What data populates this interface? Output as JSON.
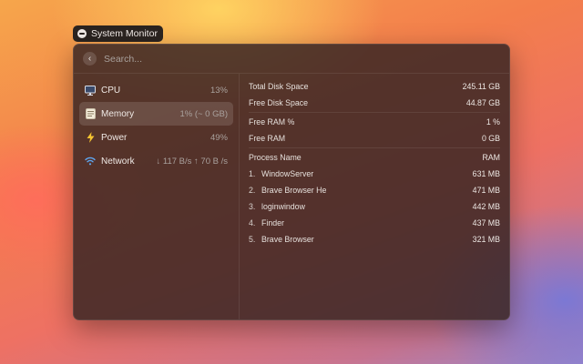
{
  "app_tag": {
    "label": "System Monitor"
  },
  "search": {
    "placeholder": "Search..."
  },
  "sidebar": {
    "items": [
      {
        "label": "CPU",
        "value": "13%",
        "icon": "monitor-icon"
      },
      {
        "label": "Memory",
        "value": "1% (~ 0 GB)",
        "icon": "memory-icon"
      },
      {
        "label": "Power",
        "value": "49%",
        "icon": "bolt-icon"
      },
      {
        "label": "Network",
        "value": "↓ 117 B/s ↑ 70 B /s",
        "icon": "wifi-icon"
      }
    ]
  },
  "detail": {
    "disk": [
      {
        "label": "Total Disk Space",
        "value": "245.11 GB"
      },
      {
        "label": "Free Disk Space",
        "value": "44.87 GB"
      }
    ],
    "ram": [
      {
        "label": "Free RAM %",
        "value": "1 %"
      },
      {
        "label": "Free RAM",
        "value": "0 GB"
      }
    ],
    "process_header": {
      "name": "Process Name",
      "value": "RAM"
    },
    "processes": [
      {
        "index": "1.",
        "name": "WindowServer",
        "value": "631 MB"
      },
      {
        "index": "2.",
        "name": "Brave Browser He",
        "value": "471 MB"
      },
      {
        "index": "3.",
        "name": "loginwindow",
        "value": "442 MB"
      },
      {
        "index": "4.",
        "name": "Finder",
        "value": "437 MB"
      },
      {
        "index": "5.",
        "name": "Brave Browser",
        "value": "321 MB"
      }
    ]
  }
}
